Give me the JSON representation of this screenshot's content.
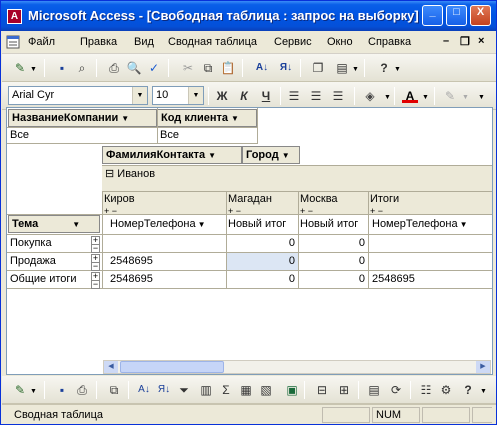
{
  "window": {
    "title": "Microsoft Access - [Свободная таблица : запрос на выборку]",
    "min_label": "_",
    "max_label": "□",
    "close_label": "X"
  },
  "menu": {
    "items": [
      "Файл",
      "Правка",
      "Вид",
      "Сводная таблица",
      "Сервис",
      "Окно",
      "Справка"
    ],
    "mdi_min": "–",
    "mdi_restore": "❐",
    "mdi_close": "×"
  },
  "format": {
    "font": "Arial Cyr",
    "size": "10",
    "bold": "Ж",
    "italic": "К",
    "underline": "Ч"
  },
  "pivot": {
    "filter_fields": [
      "НазваниеКомпании",
      "Код клиента"
    ],
    "filter_values": [
      "Все",
      "Все"
    ],
    "column_fields": [
      "ФамилияКонтакта",
      "Город"
    ],
    "group_label": "Иванов",
    "cities": [
      "Киров",
      "Магадан",
      "Москва",
      "Итоги"
    ],
    "row_field": "Тема",
    "data_headers": [
      "НомерТелефона",
      "Новый итог",
      "Новый итог",
      "НомерТелефона"
    ],
    "rows": [
      {
        "label": "Покупка",
        "values": [
          "",
          "0",
          "0",
          ""
        ]
      },
      {
        "label": "Продажа",
        "values": [
          "2548695",
          "0",
          "0",
          ""
        ]
      },
      {
        "label": "Общие итоги",
        "values": [
          "2548695",
          "0",
          "0",
          "2548695"
        ]
      }
    ]
  },
  "status": {
    "text": "Сводная таблица",
    "num": "NUM"
  },
  "colors": {
    "title_bar": "#0054e3",
    "selected_cell": "#dce6f4"
  }
}
